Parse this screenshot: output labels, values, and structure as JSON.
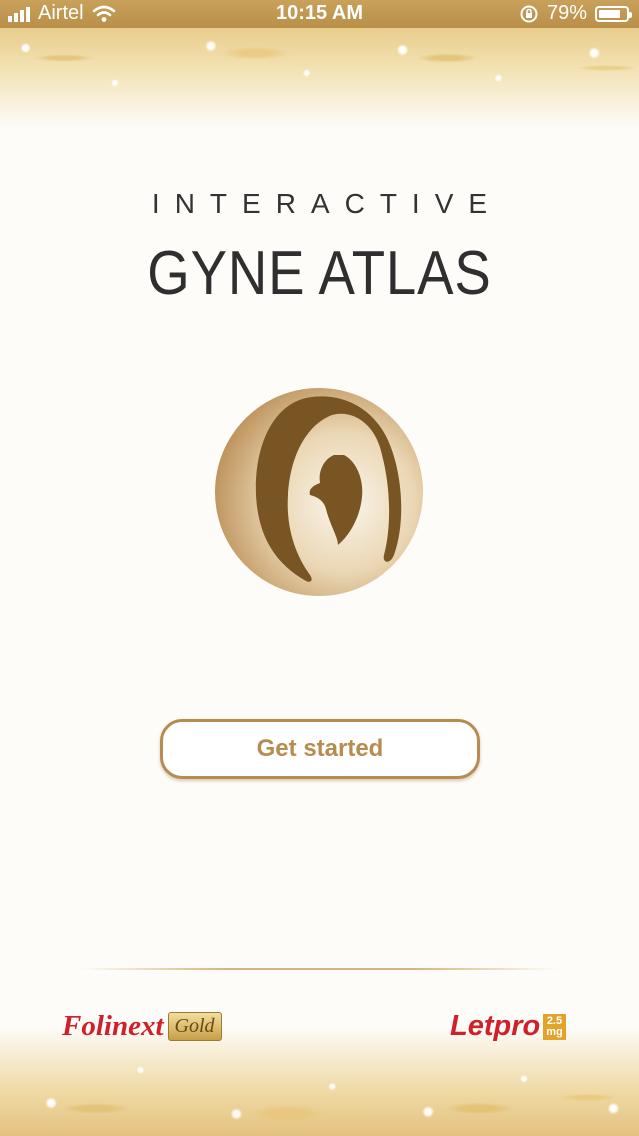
{
  "status_bar": {
    "carrier": "Airtel",
    "time": "10:15 AM",
    "battery_percent": "79%",
    "battery_level": 0.79,
    "icons": [
      "signal-icon",
      "wifi-icon",
      "orientation-lock-icon",
      "battery-icon"
    ]
  },
  "header": {
    "subtitle": "INTERACTIVE",
    "title": "GYNE ATLAS"
  },
  "logo": {
    "icon": "mother-child-icon"
  },
  "actions": {
    "get_started_label": "Get started"
  },
  "sponsors": {
    "left": {
      "name": "Folinext",
      "badge": "Gold"
    },
    "right": {
      "name": "Letpro",
      "dose_value": "2.5",
      "dose_unit": "mg"
    }
  },
  "colors": {
    "accent_gold": "#b78c50",
    "brand_red": "#d0202a",
    "background": "#fdfcf9"
  }
}
